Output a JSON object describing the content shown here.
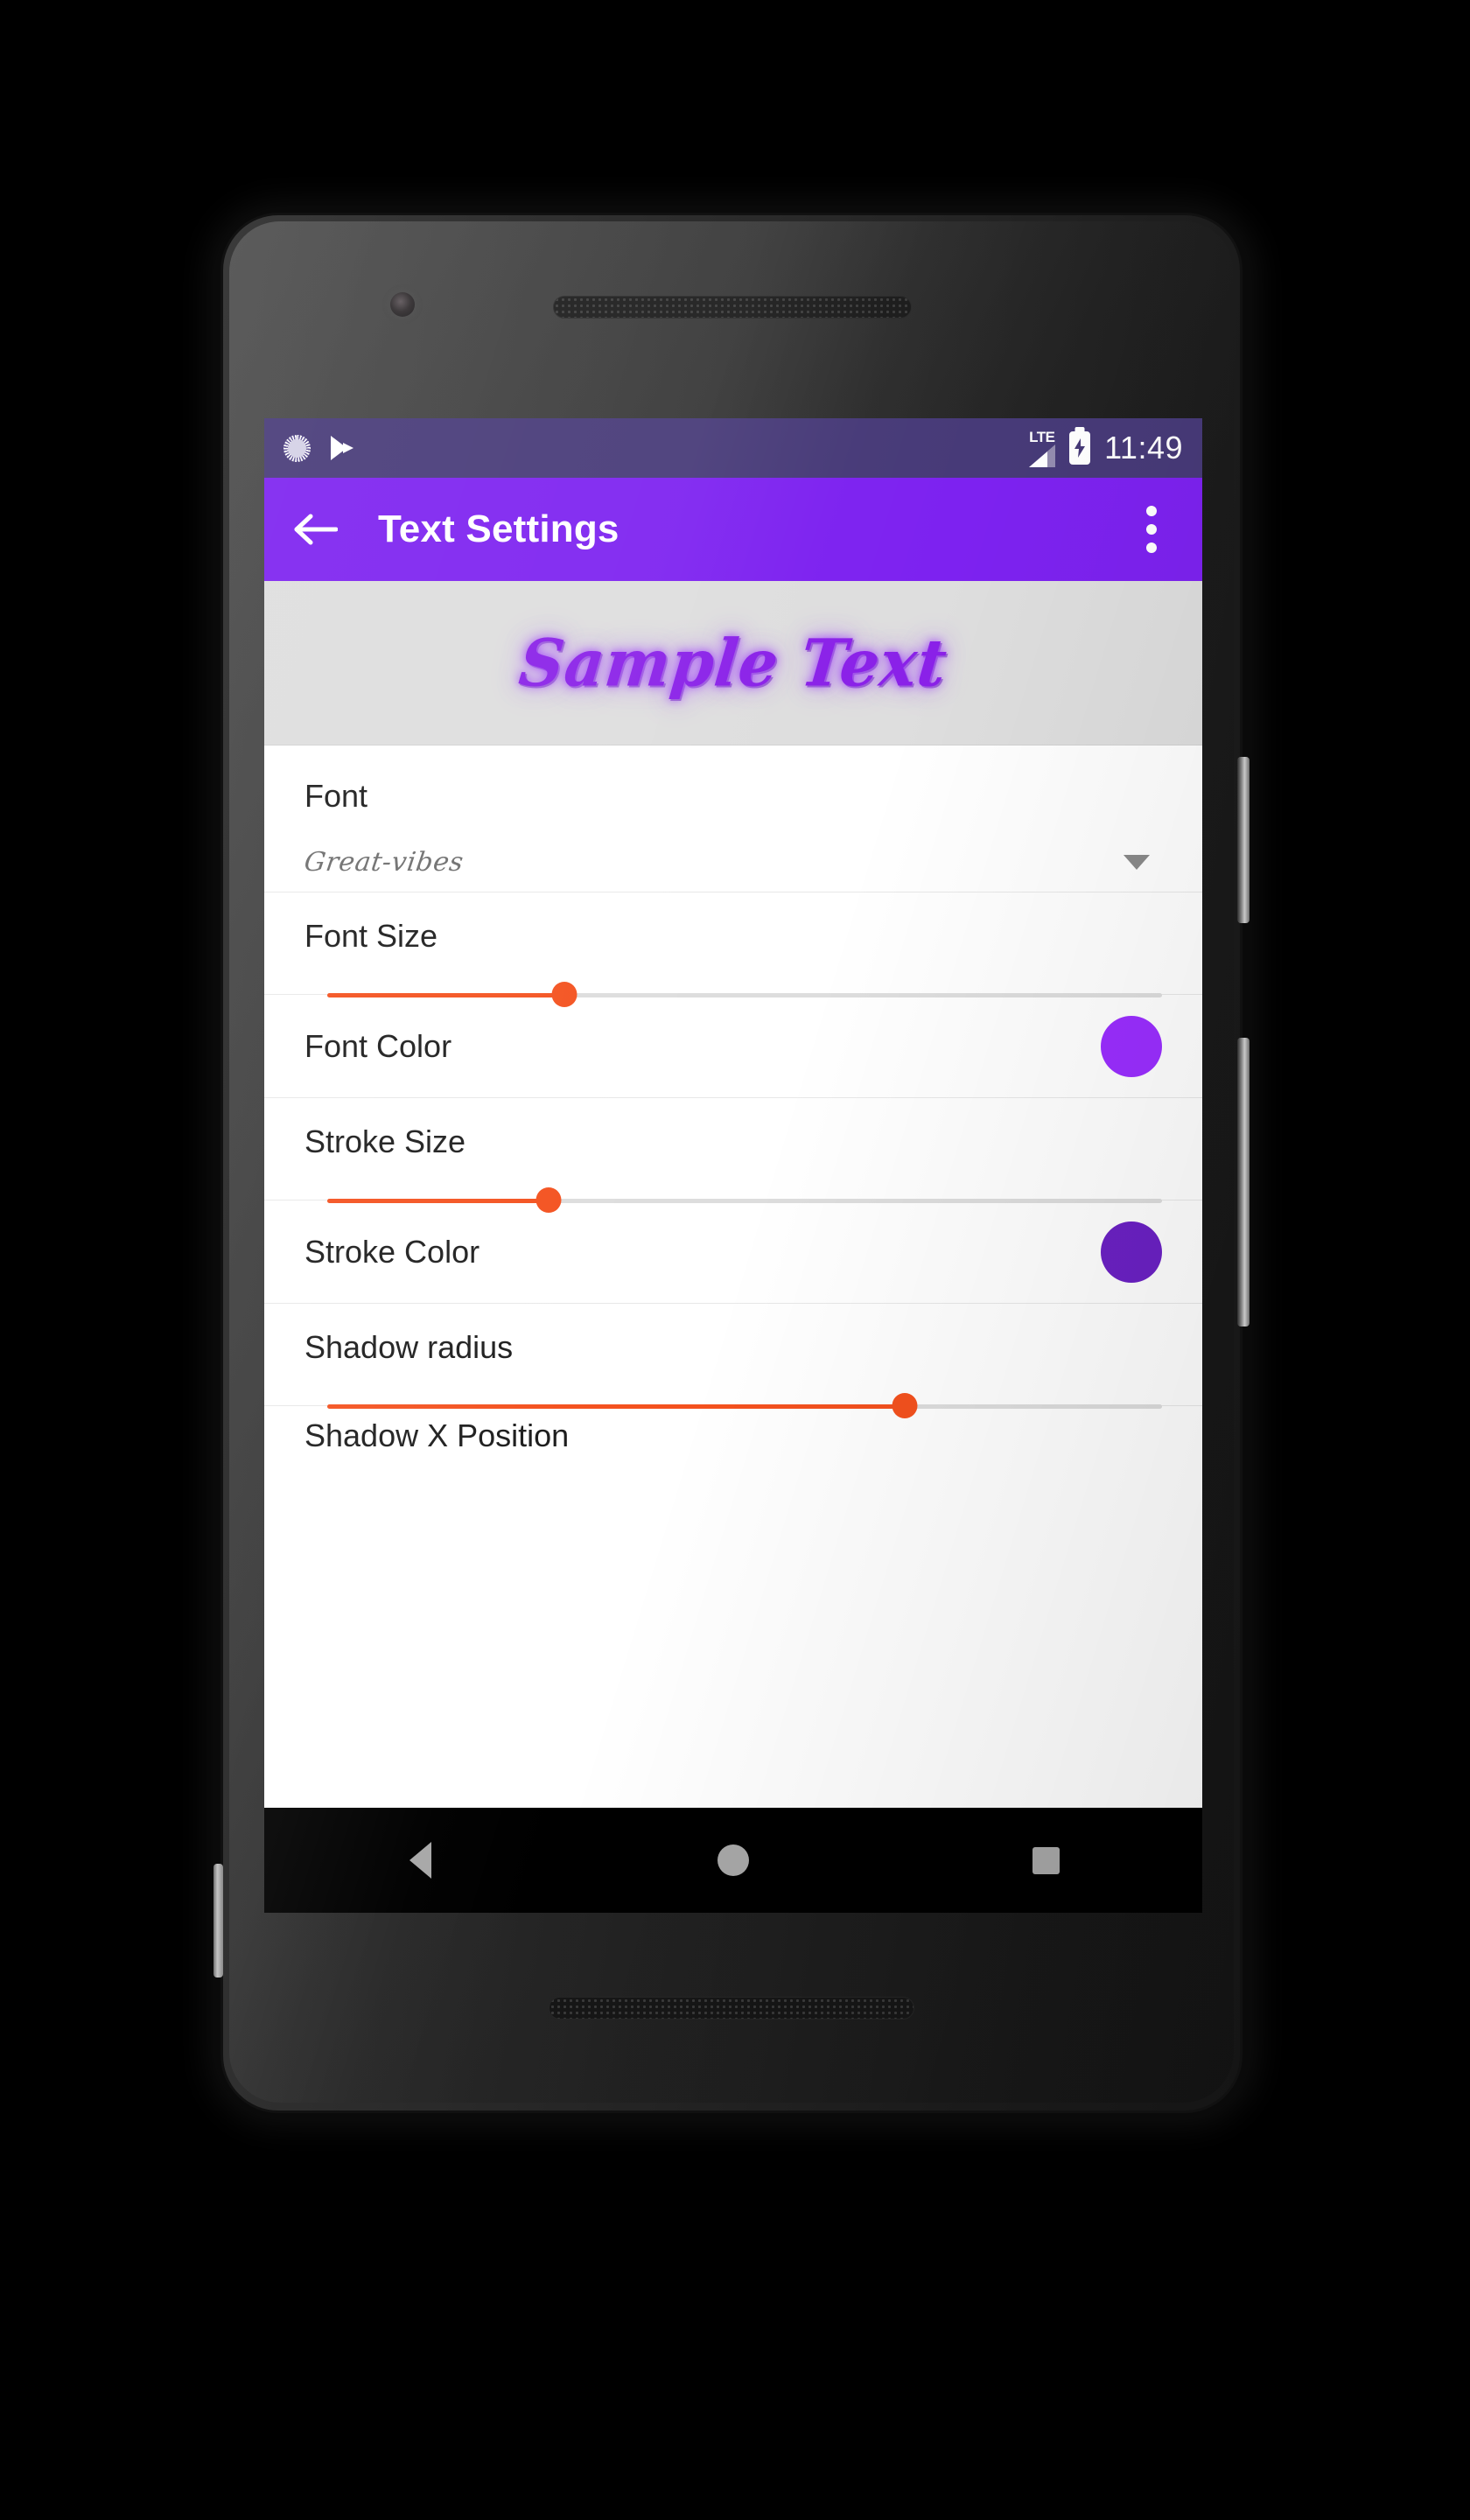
{
  "device": {
    "label": "android-phone",
    "frame_color": "#2a2a2a"
  },
  "status_bar": {
    "background": "#473a78",
    "icons": [
      "sync-icon",
      "play-store-icon"
    ],
    "network_label": "LTE",
    "battery_state": "charging",
    "time": "11:49"
  },
  "app_bar": {
    "background": "#7d22f0",
    "back_icon": "back-arrow-icon",
    "title": "Text Settings",
    "overflow_icon": "overflow-menu-icon"
  },
  "preview": {
    "background": "#dedede",
    "sample_text": "Sample Text",
    "text_color": "#8a21e8"
  },
  "settings": {
    "font": {
      "label": "Font",
      "value": "Great-vibes",
      "caret_icon": "chevron-down-icon"
    },
    "font_size": {
      "label": "Font Size",
      "value_percent": 30,
      "accent": "#f4511e"
    },
    "font_color": {
      "label": "Font Color",
      "swatch_color": "#9a2eff"
    },
    "stroke_size": {
      "label": "Stroke Size",
      "value_percent": 28,
      "accent": "#f4511e"
    },
    "stroke_color": {
      "label": "Stroke Color",
      "swatch_color": "#6b21c4"
    },
    "shadow_radius": {
      "label": "Shadow radius",
      "value_percent": 73,
      "accent": "#f4511e"
    },
    "shadow_x_position": {
      "label": "Shadow X Position"
    }
  },
  "nav_bar": {
    "background": "#000000",
    "back_label": "back-button",
    "home_label": "home-button",
    "recents_label": "recents-button"
  }
}
